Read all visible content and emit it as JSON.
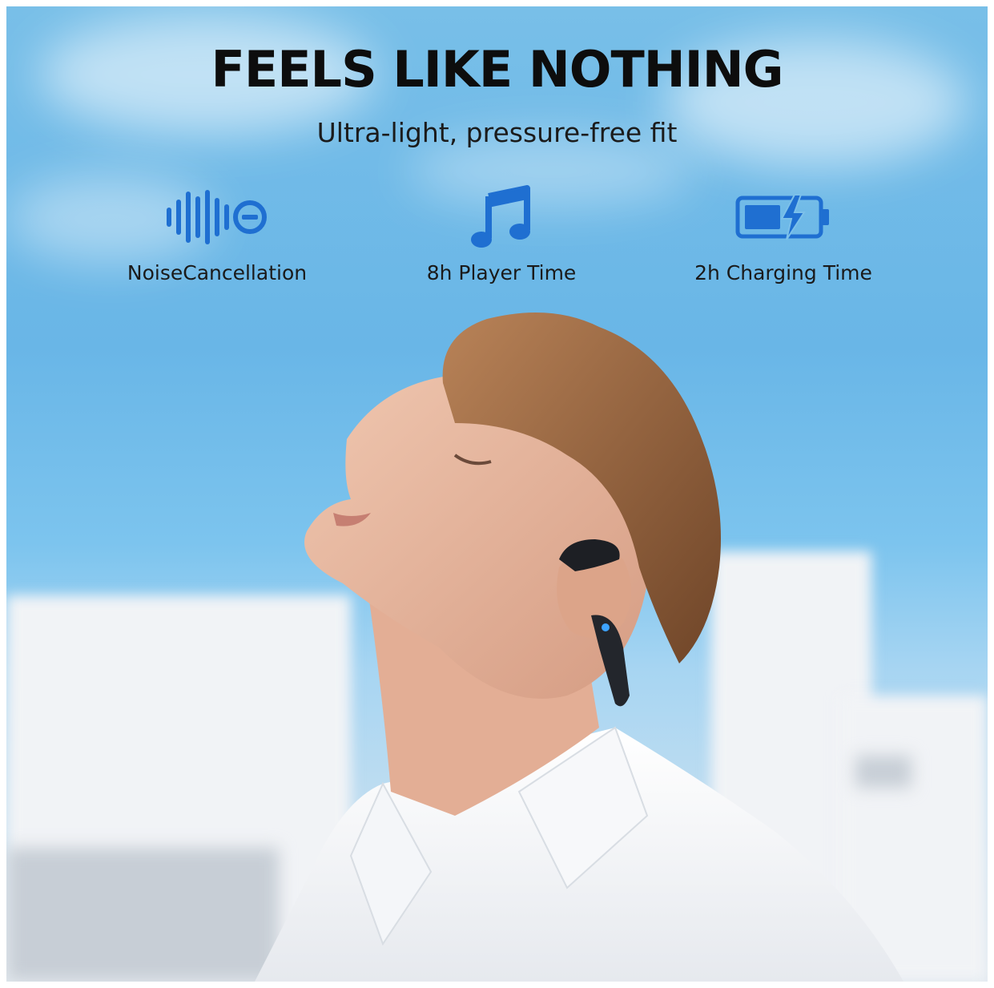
{
  "headline": "FEELS LIKE NOTHING",
  "subheadline": "Ultra-light, pressure-free fit",
  "features": [
    {
      "icon": "sound-wave-icon",
      "label": "NoiseCancellation"
    },
    {
      "icon": "music-note-icon",
      "label": "8h Player Time"
    },
    {
      "icon": "battery-charging-icon",
      "label": "2h Charging Time"
    }
  ],
  "colors": {
    "sky": "#69b6e7",
    "icon_blue": "#1f6fd1",
    "headline": "#0d0d0d"
  }
}
